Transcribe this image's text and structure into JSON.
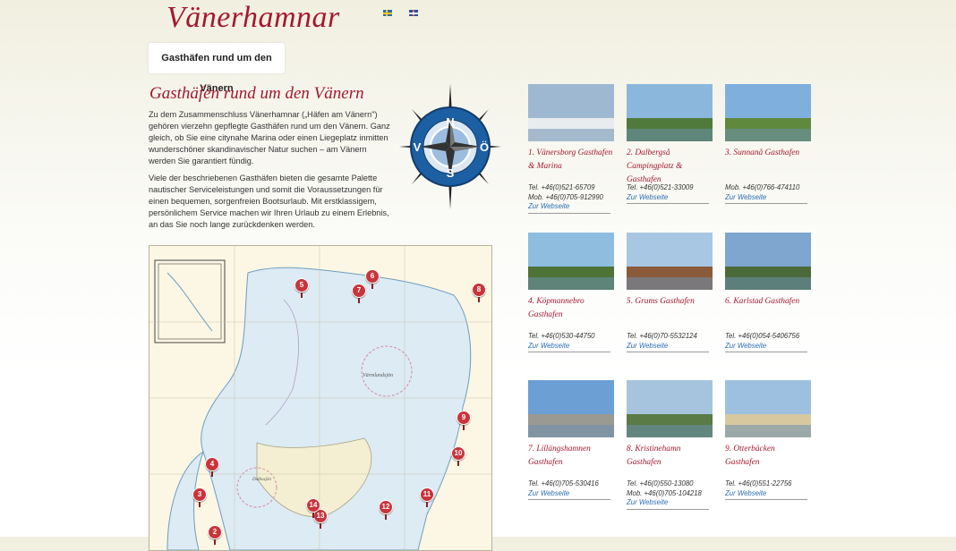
{
  "site": {
    "logo": "Vänerhamnar"
  },
  "languages": [
    {
      "name": "swedish-flag-icon",
      "colors": [
        "#2a6fb8",
        "#f3c81b"
      ]
    },
    {
      "name": "british-flag-icon",
      "colors": [
        "#2c4f9a",
        "#c8102e"
      ]
    }
  ],
  "nav": {
    "tab_label": "Gasthäfen rund um den Vänern"
  },
  "content": {
    "title": "Gasthäfen rund um den Vänern",
    "paragraph1": "Zu dem Zusammenschluss Vänerhamnar („Häfen am Vänern\") gehören vierzehn gepflegte Gasthäfen rund um den Vänern. Ganz gleich, ob Sie eine citynahe Marina oder einen Liegeplatz inmitten wunderschöner skandinavischer Natur suchen – am Vänern werden Sie garantiert fündig.",
    "paragraph2": "Viele der beschriebenen Gasthäfen bieten die gesamte Palette nautischer Serviceleistungen und somit die Voraussetzungen für einen bequemen, sorgenfreien Bootsurlaub. Mit erstklassigem, persönlichem Service machen wir Ihren Urlaub zu einem Erlebnis, an das Sie noch lange zurückdenken werden."
  },
  "compass": {
    "n": "N",
    "s": "S",
    "w": "V",
    "e": "Ö"
  },
  "map": {
    "lake_label": "Värmlandsjön",
    "bay_label": "Dalbosjön",
    "markers": [
      "2",
      "3",
      "4",
      "5",
      "6",
      "7",
      "8",
      "9",
      "10",
      "11",
      "12",
      "13",
      "14"
    ]
  },
  "harbors": [
    {
      "name": "1. Vänersborg Gasthafen & Marina",
      "tel": "Tel. +46(0)521-65709",
      "mob": "Mob. +46(0)705-912990",
      "link": "Zur Webseite",
      "colors": [
        "#9fb8d2",
        "#e8ecef"
      ]
    },
    {
      "name": "2. Dalbergså Campingplatz & Gasthafen",
      "tel": "Tel. +46(0)521-33009",
      "mob": "",
      "link": "Zur Webseite",
      "colors": [
        "#8cb7dc",
        "#4f7a3b"
      ]
    },
    {
      "name": "3. Sunnanå Gasthafen",
      "tel": "",
      "mob": "Mob. +46(0)766-474110",
      "link": "Zur Webseite",
      "colors": [
        "#7fb0dd",
        "#5f8a3e"
      ]
    },
    {
      "name": "4. Köpmannebro Gasthafen",
      "tel": "Tel. +46(0)530-44750",
      "mob": "",
      "link": "Zur Webseite",
      "colors": [
        "#8ebde0",
        "#4d7336"
      ]
    },
    {
      "name": "5. Grums Gasthafen",
      "tel": "Tel. +46(0)70-5532124",
      "mob": "",
      "link": "Zur Webseite",
      "colors": [
        "#a7c7e2",
        "#8a5b3a"
      ]
    },
    {
      "name": "6. Karlstad Gasthafen",
      "tel": "Tel. +46(0)054-5406756",
      "mob": "",
      "link": "Zur Webseite",
      "colors": [
        "#7ea6cf",
        "#4b6a3a"
      ]
    },
    {
      "name": "7. Lillängshamnen Gasthafen",
      "tel": "Tel. +46(0)705-530416",
      "mob": "",
      "link": "Zur Webseite",
      "colors": [
        "#6c9fd4",
        "#9a9a92"
      ]
    },
    {
      "name": "8. Kristinehamn Gasthafen",
      "tel": "Tel. +46(0)550-13080",
      "mob": "Mob. +46(0)705-104218",
      "link": "Zur Webseite",
      "colors": [
        "#a6c4dd",
        "#5a7b45"
      ]
    },
    {
      "name": "9. Otterbäcken Gasthafen",
      "tel": "Tel. +46(0)551-22756",
      "mob": "",
      "link": "Zur Webseite",
      "colors": [
        "#9dc0e0",
        "#d7c8a0"
      ]
    }
  ]
}
